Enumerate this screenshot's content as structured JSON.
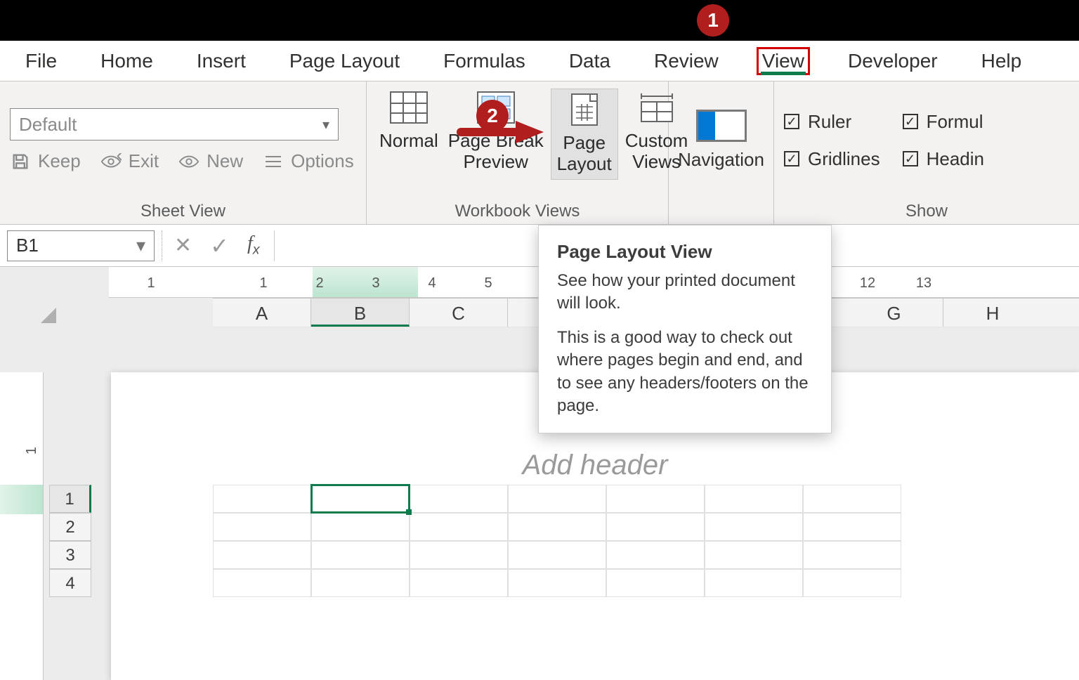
{
  "tabs": {
    "file": "File",
    "home": "Home",
    "insert": "Insert",
    "page_layout": "Page Layout",
    "formulas": "Formulas",
    "data": "Data",
    "review": "Review",
    "view": "View",
    "developer": "Developer",
    "help": "Help",
    "active": "View"
  },
  "sheet_view": {
    "combo_value": "Default",
    "keep": "Keep",
    "exit": "Exit",
    "new": "New",
    "options": "Options",
    "group_label": "Sheet View"
  },
  "workbook_views": {
    "normal": "Normal",
    "page_break_l1": "Page Break",
    "page_break_l2": "Preview",
    "page_layout_l1": "Page",
    "page_layout_l2": "Layout",
    "custom_l1": "Custom",
    "custom_l2": "Views",
    "group_label": "Workbook Views",
    "selected": "Page Layout"
  },
  "navigation": {
    "label": "Navigation"
  },
  "show": {
    "ruler": "Ruler",
    "formula_bar": "Formul",
    "gridlines": "Gridlines",
    "headings": "Headin",
    "ruler_checked": true,
    "formula_checked": true,
    "gridlines_checked": true,
    "headings_checked": true,
    "group_label": "Show"
  },
  "formula_bar": {
    "name_box": "B1",
    "value": ""
  },
  "ruler_h": {
    "marks": [
      1,
      1,
      2,
      3,
      4,
      5,
      12,
      13
    ],
    "active_start": 2,
    "active_end": 3
  },
  "columns": [
    "A",
    "B",
    "C",
    "G",
    "H"
  ],
  "selected_column": "B",
  "rows": [
    1,
    2,
    3,
    4
  ],
  "selected_row": 1,
  "page": {
    "add_header": "Add header"
  },
  "tooltip": {
    "title": "Page Layout View",
    "p1": "See how your printed document will look.",
    "p2": "This is a good way to check out where pages begin and end, and to see any headers/footers on the page."
  },
  "annotations": {
    "badge1": "1",
    "badge2": "2"
  }
}
